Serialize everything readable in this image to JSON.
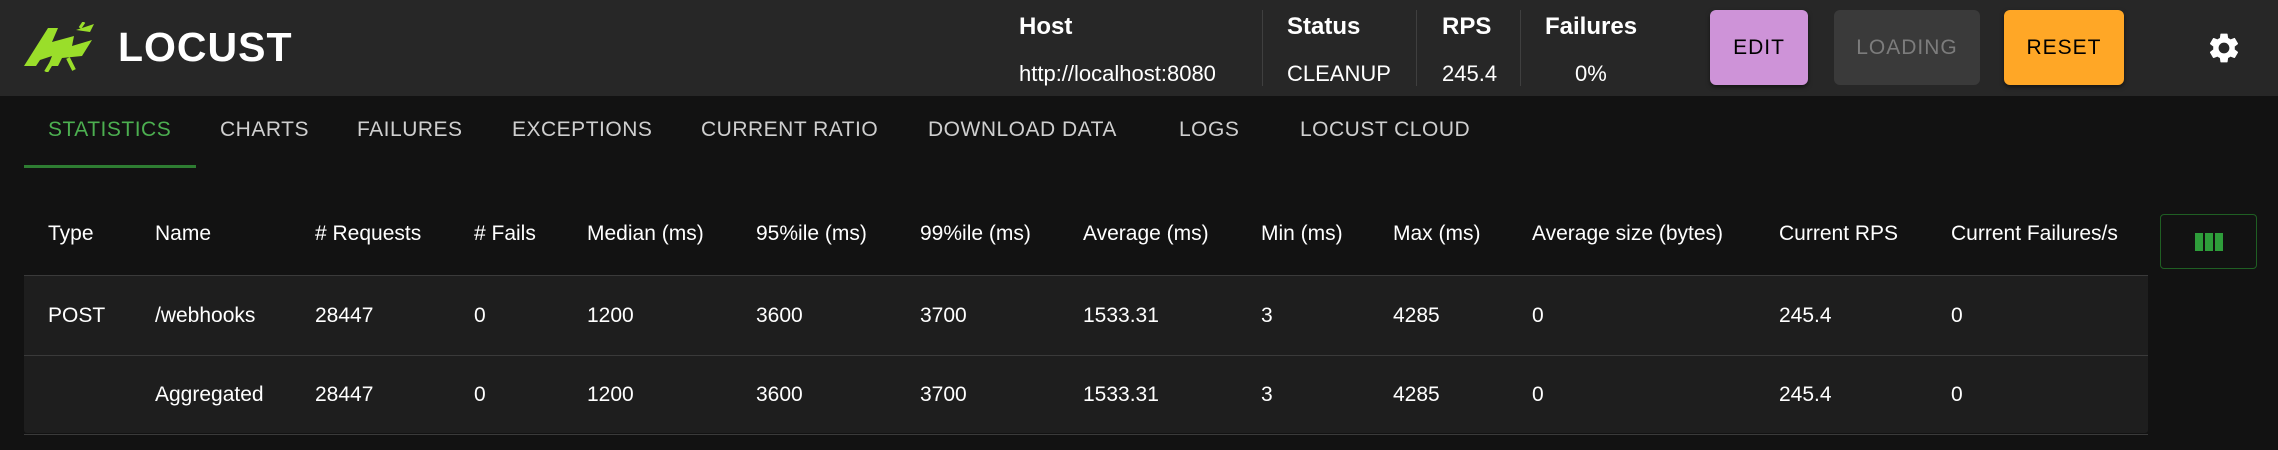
{
  "app": {
    "brand": "LOCUST",
    "accent_color": "#4caf50"
  },
  "header": {
    "host": {
      "label": "Host",
      "value": "http://localhost:8080"
    },
    "status": {
      "label": "Status",
      "value": "CLEANUP"
    },
    "rps": {
      "label": "RPS",
      "value": "245.4"
    },
    "failures": {
      "label": "Failures",
      "value": "0%"
    },
    "buttons": {
      "edit": "EDIT",
      "loading": "LOADING",
      "reset": "RESET"
    },
    "settings_icon": "gear-icon"
  },
  "tabs": [
    {
      "label": "STATISTICS",
      "active": true
    },
    {
      "label": "CHARTS"
    },
    {
      "label": "FAILURES"
    },
    {
      "label": "EXCEPTIONS"
    },
    {
      "label": "CURRENT RATIO"
    },
    {
      "label": "DOWNLOAD DATA"
    },
    {
      "label": "LOGS"
    },
    {
      "label": "LOCUST CLOUD"
    }
  ],
  "table": {
    "columns": [
      "Type",
      "Name",
      "# Requests",
      "# Fails",
      "Median (ms)",
      "95%ile (ms)",
      "99%ile (ms)",
      "Average (ms)",
      "Min (ms)",
      "Max (ms)",
      "Average size (bytes)",
      "Current RPS",
      "Current Failures/s"
    ],
    "rows": [
      [
        "POST",
        "/webhooks",
        "28447",
        "0",
        "1200",
        "3600",
        "3700",
        "1533.31",
        "3",
        "4285",
        "0",
        "245.4",
        "0"
      ],
      [
        "",
        "Aggregated",
        "28447",
        "0",
        "1200",
        "3600",
        "3700",
        "1533.31",
        "3",
        "4285",
        "0",
        "245.4",
        "0"
      ]
    ],
    "column_toggle_icon": "columns-icon"
  }
}
